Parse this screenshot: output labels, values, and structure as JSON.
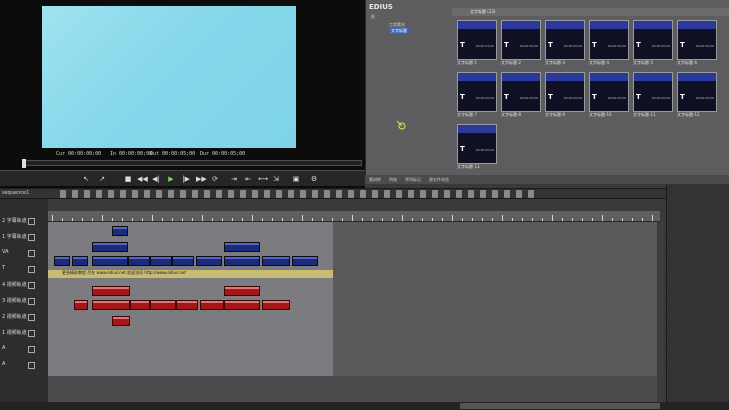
{
  "player": {
    "timecodes": [
      "Cur 00:00:00;00",
      "In 00:00:00;00",
      "Out 00:00:05;00",
      "Dur 00:00:05;00"
    ]
  },
  "bin": {
    "app_title": "EDIUS",
    "tree": [
      "根",
      "工程素材",
      "文字标题"
    ],
    "folder_path": "文字标题 (13)",
    "clips": [
      {
        "tc": "00:00:03;00",
        "label": "文字标题-1"
      },
      {
        "tc": "00:00:05;00",
        "label": "文字标题-2"
      },
      {
        "tc": "00:00:05;00",
        "label": "文字标题-3"
      },
      {
        "tc": "00:00:05;00",
        "label": "文字标题-4"
      },
      {
        "tc": "00:00:05;00",
        "label": "文字标题-5"
      },
      {
        "tc": "00:00:05;00",
        "label": "文字标题-6"
      },
      {
        "tc": "00:00:05;00",
        "label": "文字标题-7"
      },
      {
        "tc": "00:00:05;00",
        "label": "文字标题-8"
      },
      {
        "tc": "00:00:05;00",
        "label": "文字标题-9"
      },
      {
        "tc": "00:00:05;00",
        "label": "文字标题-10"
      },
      {
        "tc": "00:00:05;00",
        "label": "文字标题-11"
      },
      {
        "tc": "00:00:05;00",
        "label": "文字标题-12"
      },
      {
        "tc": "00:00:05;00",
        "label": "文字标题-13"
      }
    ],
    "tabs": [
      "素材库",
      "特效",
      "序列标记",
      "源文件浏览"
    ]
  },
  "timeline": {
    "sequence_tab": "sequence1",
    "tracks": [
      "2 字幕轨道",
      "1 字幕轨道",
      "VA",
      "T",
      "4 视频轨道",
      "3 视频轨道",
      "2 视频轨道",
      "1 视频轨道",
      "A",
      "A"
    ],
    "title_bar_text": "更多精彩教程 尽在 www.edius.net  欢迎访问  http://www.edius.net"
  }
}
